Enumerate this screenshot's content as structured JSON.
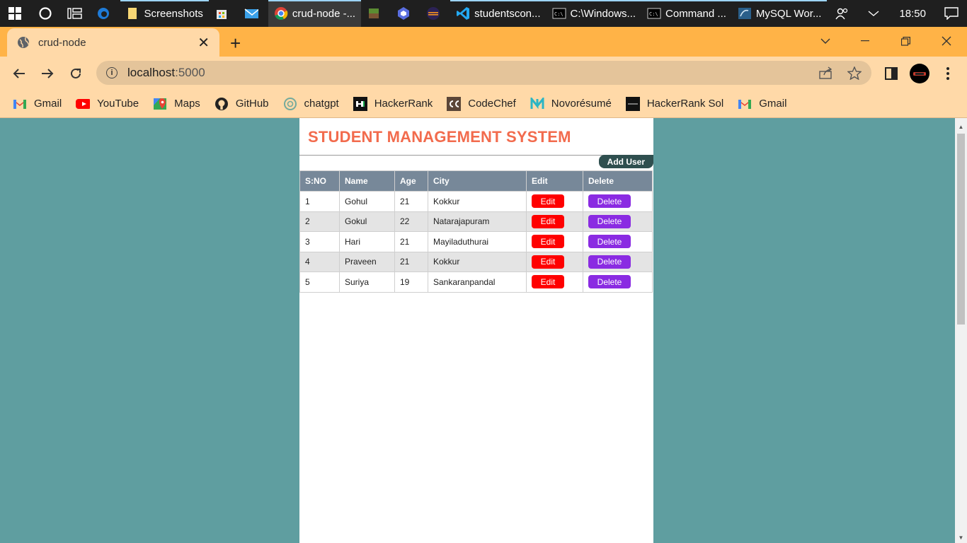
{
  "taskbar": {
    "apps": [
      {
        "label": "",
        "icon": "edge-icon"
      },
      {
        "label": "Screenshots",
        "icon": "folder-icon"
      },
      {
        "label": "",
        "icon": "store-icon"
      },
      {
        "label": "",
        "icon": "mail-icon"
      },
      {
        "label": "crud-node -...",
        "icon": "chrome-icon"
      },
      {
        "label": "",
        "icon": "minecraft-icon"
      },
      {
        "label": "",
        "icon": "app-icon"
      },
      {
        "label": "",
        "icon": "eclipse-icon"
      },
      {
        "label": "studentscon...",
        "icon": "vscode-icon"
      },
      {
        "label": "C:\\Windows...",
        "icon": "cmd-icon"
      },
      {
        "label": "Command ...",
        "icon": "cmd-icon"
      },
      {
        "label": "MySQL Wor...",
        "icon": "mysql-icon"
      }
    ],
    "clock": "18:50"
  },
  "browser": {
    "tab_title": "crud-node",
    "url_host": "localhost",
    "url_port": ":5000",
    "bookmarks": [
      {
        "label": "Gmail",
        "icon": "gmail-icon"
      },
      {
        "label": "YouTube",
        "icon": "youtube-icon"
      },
      {
        "label": "Maps",
        "icon": "maps-icon"
      },
      {
        "label": "GitHub",
        "icon": "github-icon"
      },
      {
        "label": "chatgpt",
        "icon": "chatgpt-icon"
      },
      {
        "label": "HackerRank",
        "icon": "hackerrank-icon"
      },
      {
        "label": "CodeChef",
        "icon": "codechef-icon"
      },
      {
        "label": "Novorésumé",
        "icon": "novoresume-icon"
      },
      {
        "label": "HackerRank Sol",
        "icon": "hackerrank-sol-icon"
      },
      {
        "label": "Gmail",
        "icon": "gmail-icon"
      }
    ]
  },
  "page": {
    "title": "STUDENT MANAGEMENT SYSTEM",
    "add_user_label": "Add User",
    "columns": [
      "S:NO",
      "Name",
      "Age",
      "City",
      "Edit",
      "Delete"
    ],
    "rows": [
      {
        "sno": "1",
        "name": "Gohul",
        "age": "21",
        "city": "Kokkur"
      },
      {
        "sno": "2",
        "name": "Gokul",
        "age": "22",
        "city": "Natarajapuram"
      },
      {
        "sno": "3",
        "name": "Hari",
        "age": "21",
        "city": "Mayiladuthurai"
      },
      {
        "sno": "4",
        "name": "Praveen",
        "age": "21",
        "city": "Kokkur"
      },
      {
        "sno": "5",
        "name": "Suriya",
        "age": "19",
        "city": "Sankaranpandal"
      }
    ],
    "edit_label": "Edit",
    "delete_label": "Delete"
  },
  "colors": {
    "page_bg": "#5f9ea0",
    "title": "#f26b4d",
    "header_bg": "#778899",
    "edit_btn": "#ff0000",
    "delete_btn": "#8a2be2",
    "add_user_btn": "#2f4f4f"
  }
}
